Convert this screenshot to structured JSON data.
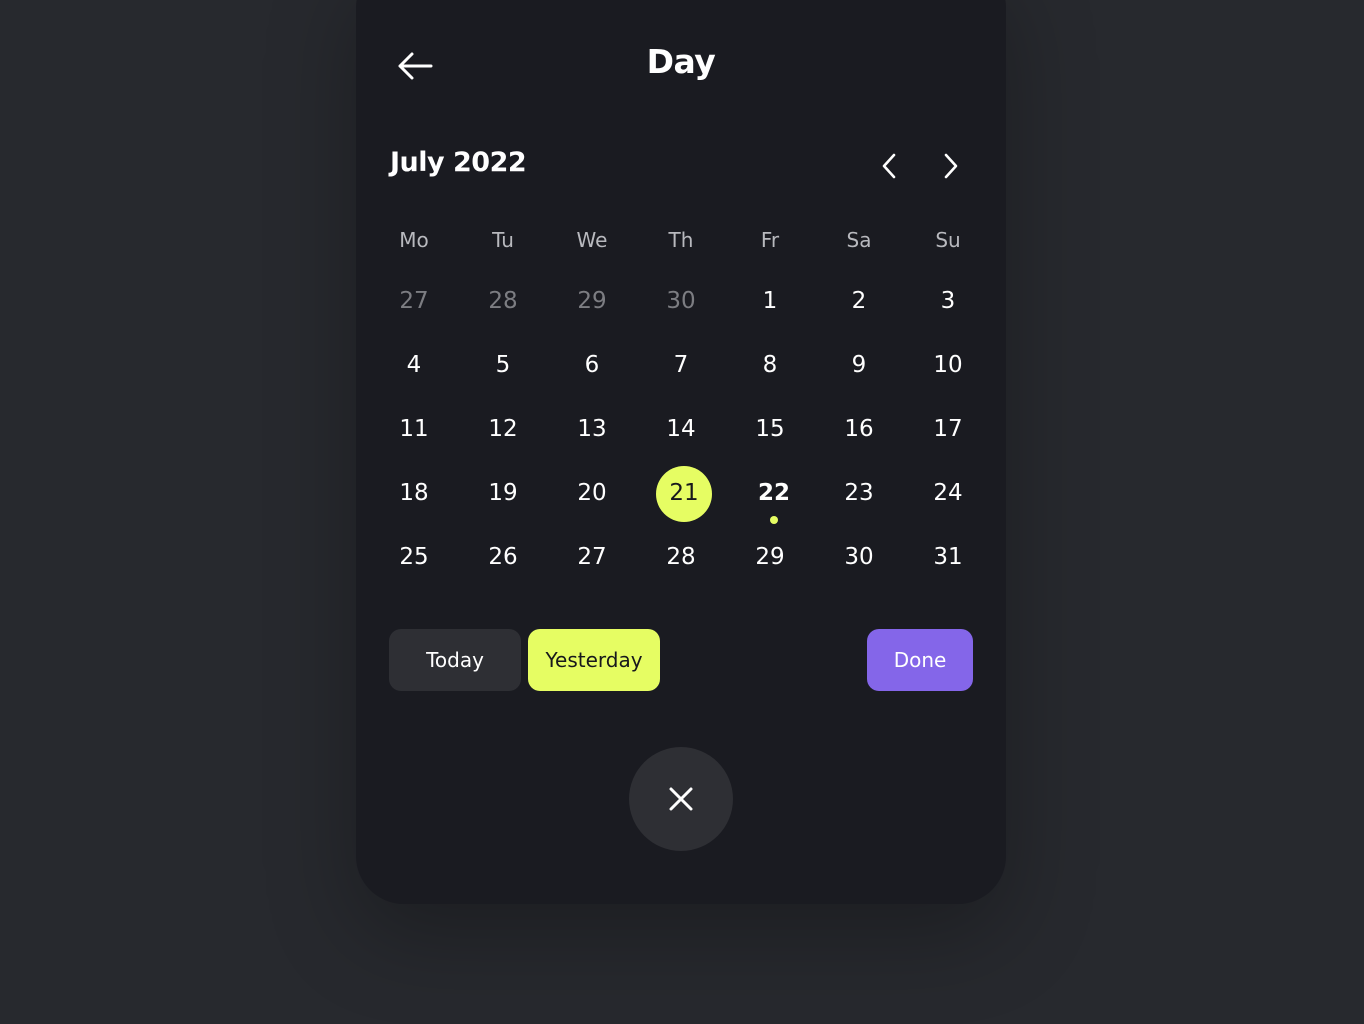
{
  "header": {
    "title": "Day",
    "back_icon": "arrow-left-icon"
  },
  "calendar": {
    "month_label": "July 2022",
    "prev_icon": "chevron-left-icon",
    "next_icon": "chevron-right-icon",
    "weekdays": [
      "Mo",
      "Tu",
      "We",
      "Th",
      "Fr",
      "Sa",
      "Su"
    ],
    "weeks": [
      [
        "27",
        "28",
        "29",
        "30",
        "1",
        "2",
        "3"
      ],
      [
        "4",
        "5",
        "6",
        "7",
        "8",
        "9",
        "10"
      ],
      [
        "11",
        "12",
        "13",
        "14",
        "15",
        "16",
        "17"
      ],
      [
        "18",
        "19",
        "20",
        "21",
        "22",
        "23",
        "24"
      ],
      [
        "25",
        "26",
        "27",
        "28",
        "29",
        "30",
        "31"
      ]
    ],
    "selected_day": "21",
    "current_day": "22"
  },
  "actions": {
    "today_label": "Today",
    "yesterday_label": "Yesterday",
    "done_label": "Done",
    "close_icon": "close-icon"
  },
  "colors": {
    "background": "#27292e",
    "panel": "#1a1b21",
    "accent_lime": "#e6fd63",
    "accent_purple": "#8466e9",
    "button_dark": "#2e2f34",
    "muted_text": "#7c7d82"
  }
}
